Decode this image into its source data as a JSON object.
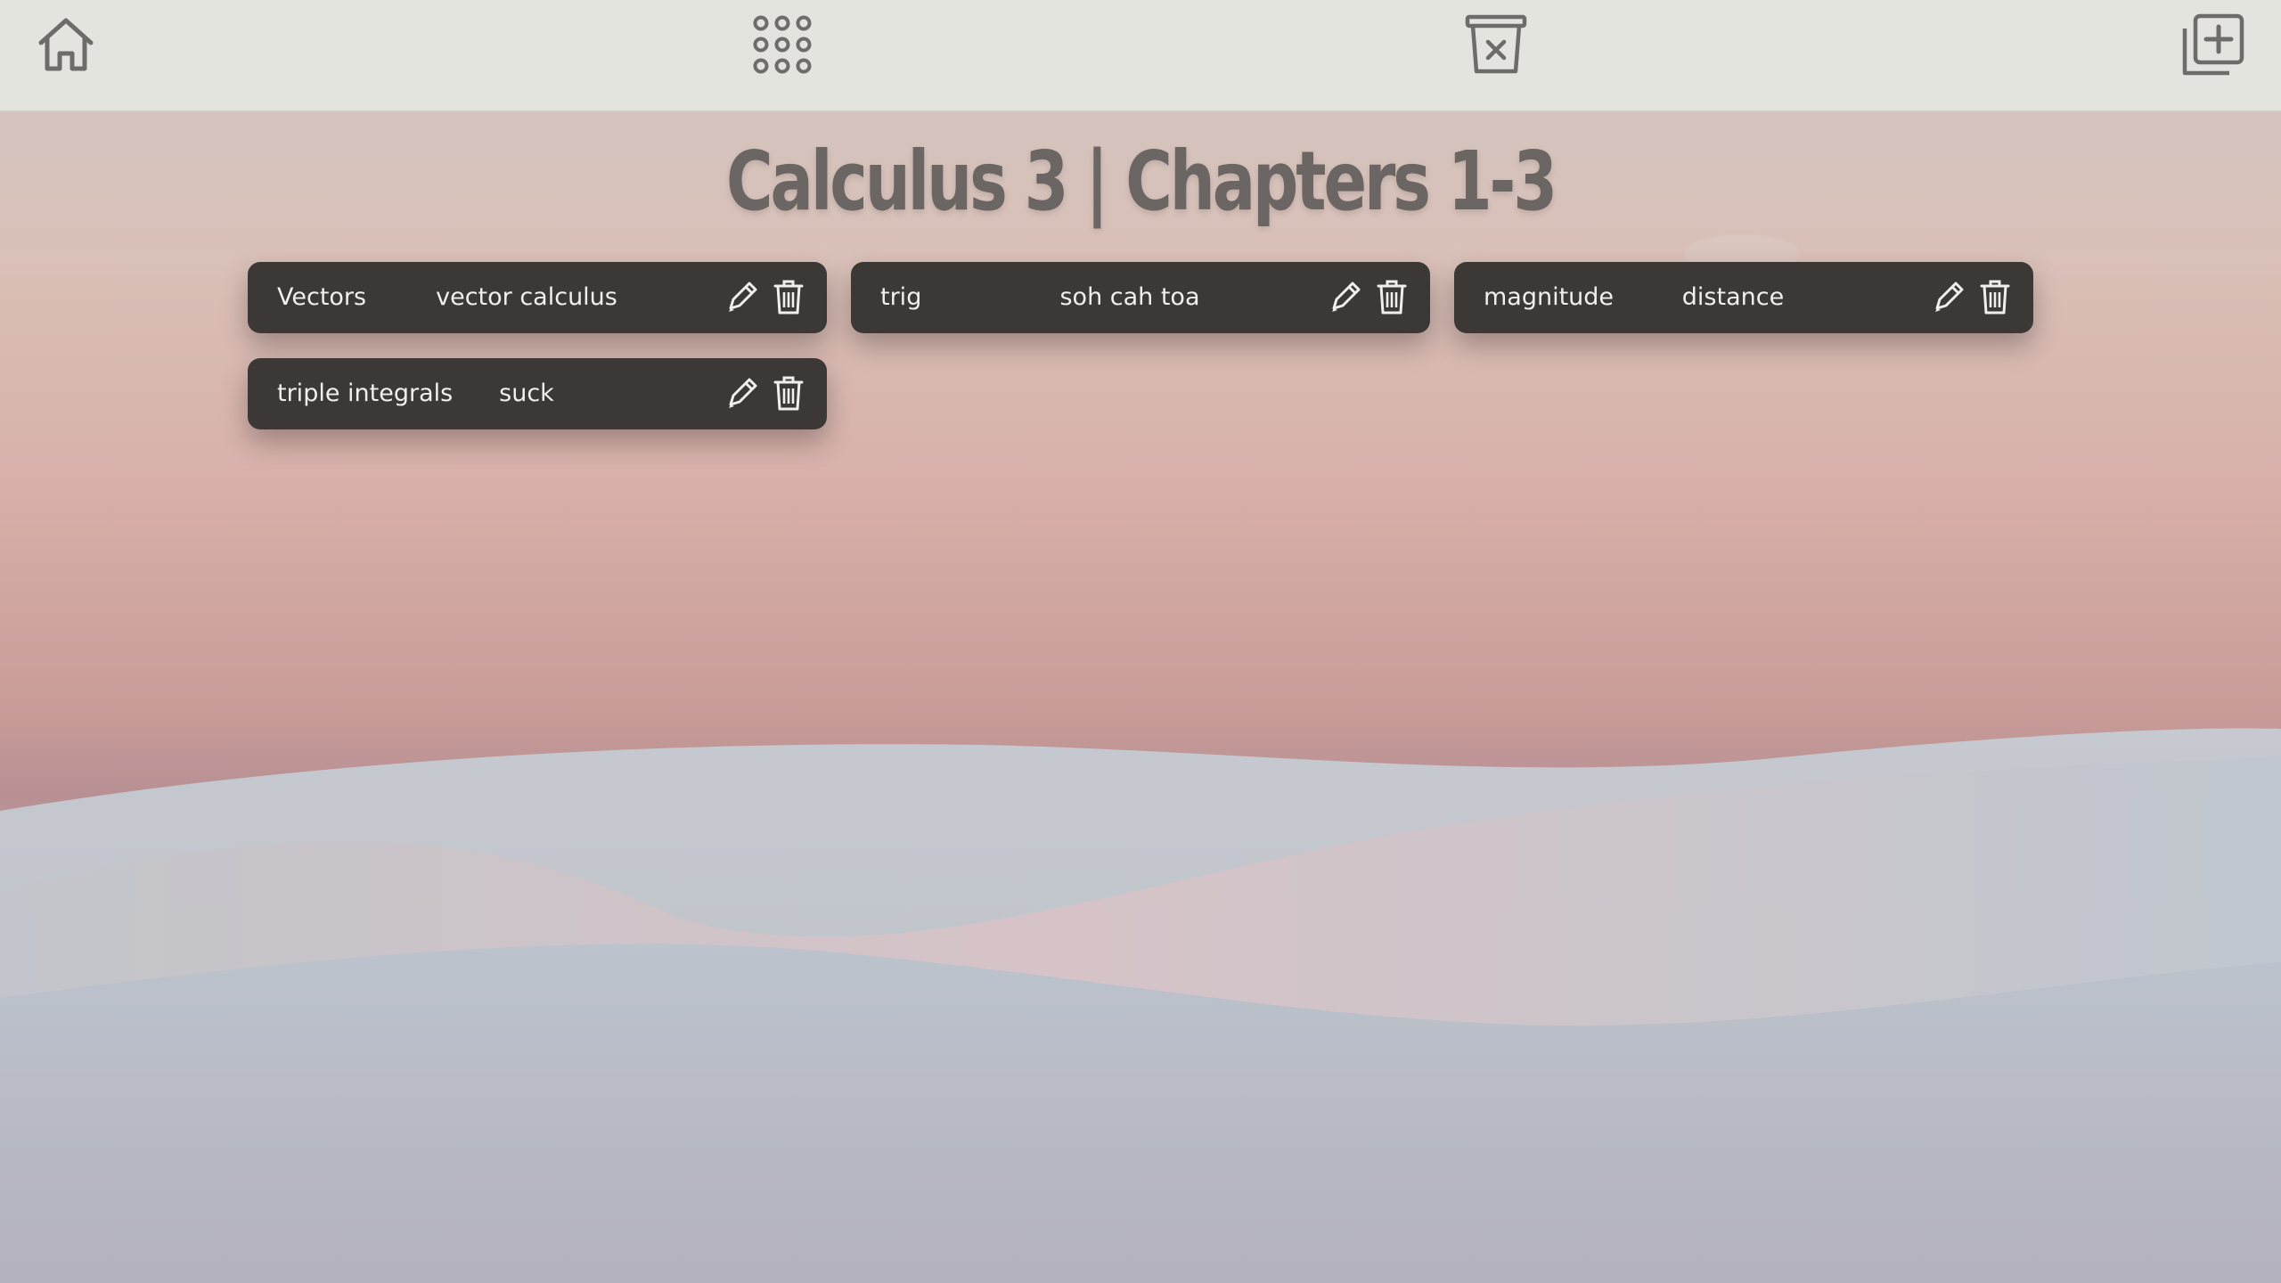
{
  "toolbar": {
    "home_icon": "home-icon",
    "apps_icon": "grid-dots-icon",
    "clear_icon": "trash-x-icon",
    "add_icon": "add-card-icon"
  },
  "page": {
    "title": "Calculus 3 | Chapters 1-3"
  },
  "cards": [
    {
      "term": "Vectors",
      "definition": "vector calculus"
    },
    {
      "term": "trig",
      "definition": "soh cah toa"
    },
    {
      "term": "magnitude",
      "definition": "distance"
    },
    {
      "term": "triple integrals",
      "definition": "suck"
    }
  ],
  "colors": {
    "card_bg": "#3b3836",
    "card_text": "#f1efec",
    "title": "#6b6563",
    "topbar_bg": "#e4e4df",
    "icon": "#6e6c69"
  }
}
